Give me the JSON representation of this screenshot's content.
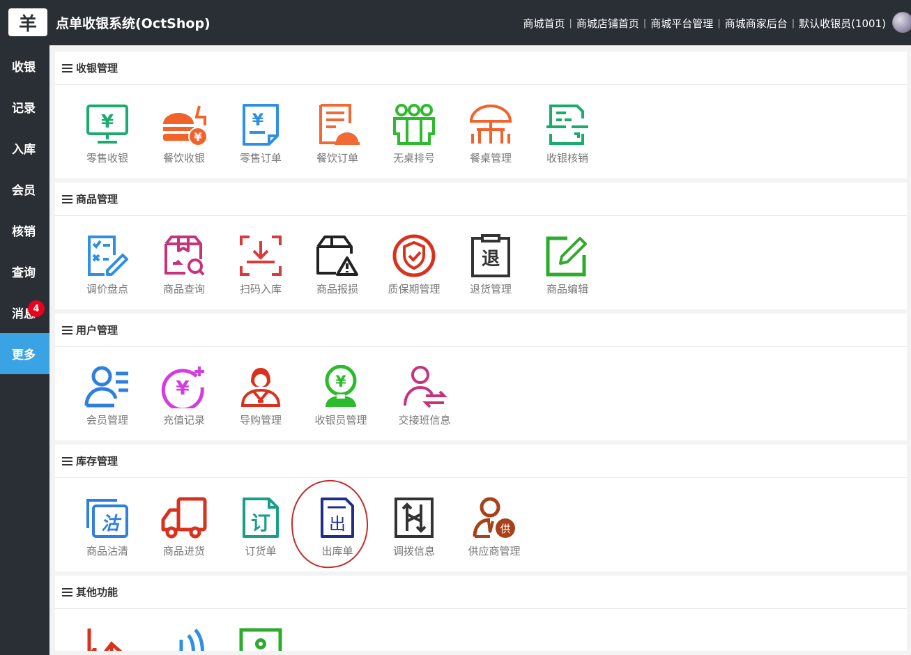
{
  "header": {
    "logo_text": "羊",
    "title": "点单收银系统(OctShop)",
    "nav": [
      "商城首页",
      "商城店铺首页",
      "商城平台管理",
      "商城商家后台",
      "默认收银员(1001)"
    ],
    "separator": "|"
  },
  "sidebar": {
    "items": [
      {
        "label": "收银"
      },
      {
        "label": "记录"
      },
      {
        "label": "入库"
      },
      {
        "label": "会员"
      },
      {
        "label": "核销"
      },
      {
        "label": "查询"
      },
      {
        "label": "消息",
        "badge": "4"
      },
      {
        "label": "更多",
        "active": true
      }
    ]
  },
  "sections": [
    {
      "title": "收银管理",
      "items": [
        {
          "label": "零售收银",
          "icon": "monitor-yen-icon",
          "color": "#1aab6e"
        },
        {
          "label": "餐饮收银",
          "icon": "burger-drink-icon",
          "color": "#f2632b"
        },
        {
          "label": "零售订单",
          "icon": "yen-document-icon",
          "color": "#2f8fe0"
        },
        {
          "label": "餐饮订单",
          "icon": "food-order-icon",
          "color": "#ef6a35"
        },
        {
          "label": "无桌排号",
          "icon": "people-queue-icon",
          "color": "#2dbb2d"
        },
        {
          "label": "餐桌管理",
          "icon": "table-umbrella-icon",
          "color": "#f2632b"
        },
        {
          "label": "收银核销",
          "icon": "scan-verify-icon",
          "color": "#1aab6e"
        }
      ]
    },
    {
      "title": "商品管理",
      "items": [
        {
          "label": "调价盘点",
          "icon": "checklist-pencil-icon",
          "color": "#2f8fe0"
        },
        {
          "label": "商品查询",
          "icon": "box-search-icon",
          "color": "#c8327a"
        },
        {
          "label": "扫码入库",
          "icon": "scan-inbound-icon",
          "color": "#d83b3b"
        },
        {
          "label": "商品报损",
          "icon": "box-warning-icon",
          "color": "#222222"
        },
        {
          "label": "质保期管理",
          "icon": "shield-check-icon",
          "color": "#d8321f"
        },
        {
          "label": "退货管理",
          "icon": "return-clipboard-icon",
          "color": "#333333"
        },
        {
          "label": "商品编辑",
          "icon": "edit-square-icon",
          "color": "#2dab2d"
        }
      ]
    },
    {
      "title": "用户管理",
      "items": [
        {
          "label": "会员管理",
          "icon": "member-list-icon",
          "color": "#2f7fe0"
        },
        {
          "label": "充值记录",
          "icon": "yen-plus-icon",
          "color": "#d43be0"
        },
        {
          "label": "导购管理",
          "icon": "shop-assistant-icon",
          "color": "#d8321f"
        },
        {
          "label": "收银员管理",
          "icon": "cashier-icon",
          "color": "#2dbb2d"
        },
        {
          "label": "交接班信息",
          "icon": "user-swap-icon",
          "color": "#c8327a"
        }
      ]
    },
    {
      "title": "库存管理",
      "items": [
        {
          "label": "商品沽清",
          "icon": "sold-out-icon",
          "color": "#2f7fe0"
        },
        {
          "label": "商品进货",
          "icon": "truck-icon",
          "color": "#d8321f"
        },
        {
          "label": "订货单",
          "icon": "order-form-icon",
          "color": "#1a9e8a"
        },
        {
          "label": "出库单",
          "icon": "outbound-doc-icon",
          "color": "#1e2f8a"
        },
        {
          "label": "调拨信息",
          "icon": "transfer-arrows-icon",
          "color": "#333333"
        },
        {
          "label": "供应商管理",
          "icon": "supplier-icon",
          "color": "#a8401a"
        }
      ]
    },
    {
      "title": "其他功能",
      "items": [
        {
          "label": "",
          "icon": "bar-chart-icon",
          "color": "#d8321f"
        },
        {
          "label": "",
          "icon": "speaker-icon",
          "color": "#2f8fe0"
        },
        {
          "label": "",
          "icon": "settings-doc-icon",
          "color": "#2dab2d"
        }
      ]
    }
  ],
  "glyphs": {
    "yen": "¥",
    "return": "退",
    "sold_out": "沽",
    "order": "订",
    "outbound": "出",
    "supplier": "供"
  }
}
